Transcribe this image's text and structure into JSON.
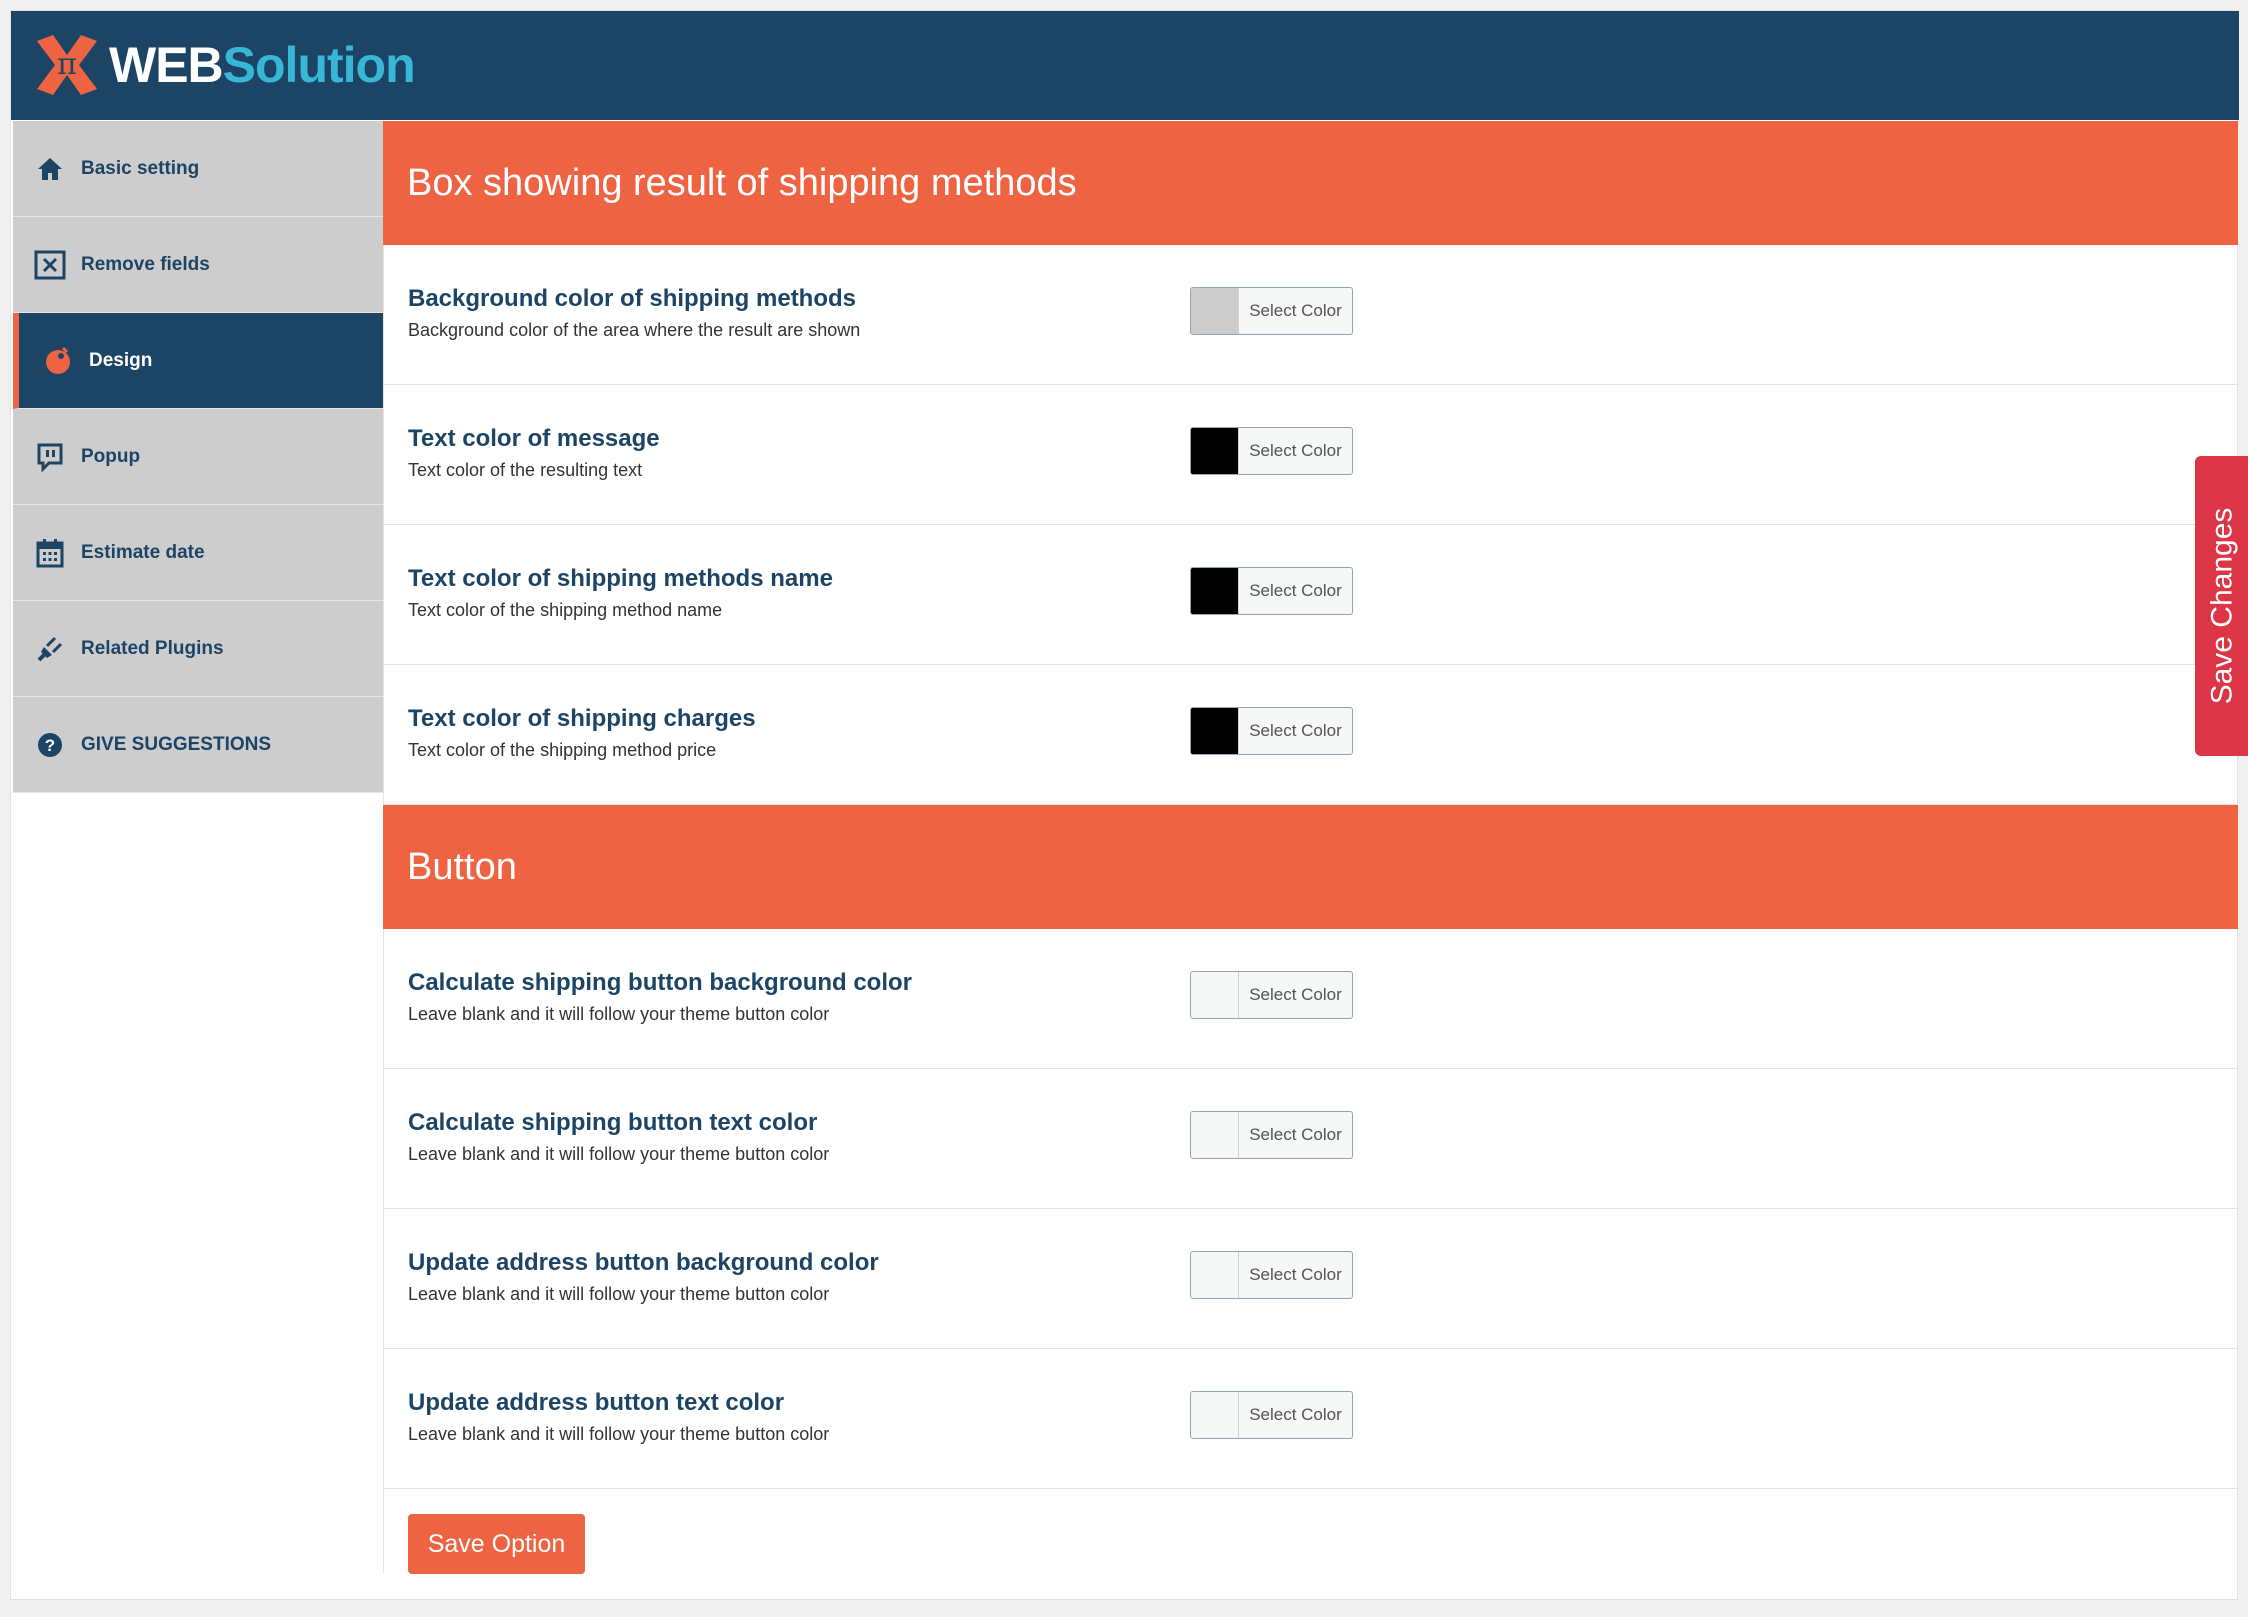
{
  "brand": {
    "logo_part1": "WEB",
    "logo_part2": "Solution",
    "primary_color": "#1c4565",
    "accent_color": "#ee6443",
    "secondary_color": "#38b6d6"
  },
  "sidebar": {
    "items": [
      {
        "label": "Basic setting",
        "icon": "home-icon",
        "active": false
      },
      {
        "label": "Remove fields",
        "icon": "remove-box-icon",
        "active": false
      },
      {
        "label": "Design",
        "icon": "palette-icon",
        "active": true
      },
      {
        "label": "Popup",
        "icon": "popup-icon",
        "active": false
      },
      {
        "label": "Estimate date",
        "icon": "calendar-icon",
        "active": false
      },
      {
        "label": "Related Plugins",
        "icon": "plug-icon",
        "active": false
      },
      {
        "label": "GIVE SUGGESTIONS",
        "icon": "question-icon",
        "active": false
      }
    ]
  },
  "sections": [
    {
      "heading": "Box showing result of shipping methods",
      "fields": [
        {
          "title": "Background color of shipping methods",
          "desc": "Background color of the area where the result are shown",
          "button": "Select Color",
          "swatch": "#cccccc"
        },
        {
          "title": "Text color of message",
          "desc": "Text color of the resulting text",
          "button": "Select Color",
          "swatch": "#000000"
        },
        {
          "title": "Text color of shipping methods name",
          "desc": "Text color of the shipping method name",
          "button": "Select Color",
          "swatch": "#000000"
        },
        {
          "title": "Text color of shipping charges",
          "desc": "Text color of the shipping method price",
          "button": "Select Color",
          "swatch": "#000000"
        }
      ]
    },
    {
      "heading": "Button",
      "fields": [
        {
          "title": "Calculate shipping button background color",
          "desc": "Leave blank and it will follow your theme button color",
          "button": "Select Color",
          "swatch": "#f6f7f7"
        },
        {
          "title": "Calculate shipping button text color",
          "desc": "Leave blank and it will follow your theme button color",
          "button": "Select Color",
          "swatch": "#f6f7f7"
        },
        {
          "title": "Update address button background color",
          "desc": "Leave blank and it will follow your theme button color",
          "button": "Select Color",
          "swatch": "#f6f7f7"
        },
        {
          "title": "Update address button text color",
          "desc": "Leave blank and it will follow your theme button color",
          "button": "Select Color",
          "swatch": "#f6f7f7"
        }
      ]
    }
  ],
  "actions": {
    "save_option": "Save Option",
    "save_changes": "Save Changes"
  }
}
